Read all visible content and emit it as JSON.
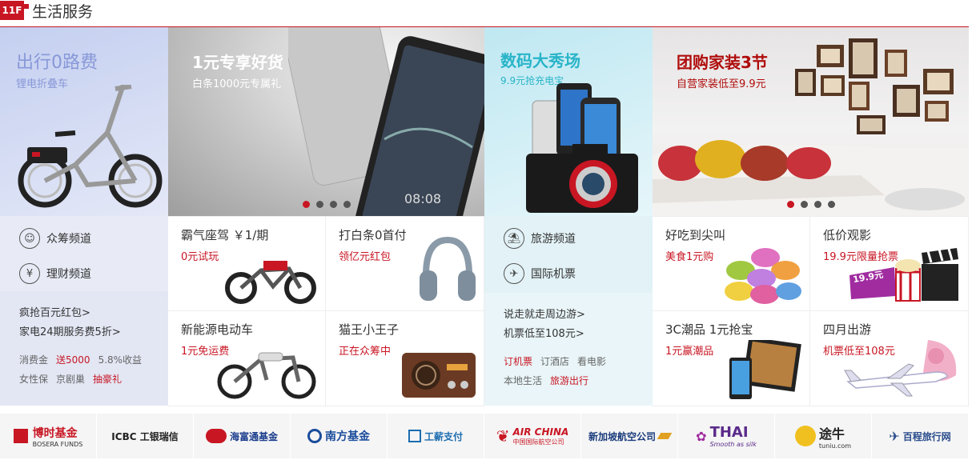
{
  "floor": {
    "number": "11F",
    "title": "生活服务"
  },
  "col1": {
    "title": "出行0路费",
    "subtitle": "锂电折叠车",
    "menu": [
      {
        "label": "众筹频道",
        "icon": "crowdfunding-icon"
      },
      {
        "label": "理财频道",
        "icon": "yen-icon"
      }
    ],
    "links": [
      "疯抢百元红包>",
      "家电24期服务费5折>"
    ],
    "tags": [
      {
        "text": "消费金",
        "hot": false
      },
      {
        "text": "送5000",
        "hot": true
      },
      {
        "text": "5.8%收益",
        "hot": false
      },
      {
        "text": "女性保",
        "hot": false
      },
      {
        "text": "京剧巢",
        "hot": false
      },
      {
        "text": "抽豪礼",
        "hot": true
      }
    ]
  },
  "col2": {
    "banner": {
      "title": "1元专享好货",
      "subtitle": "白条1000元专属礼",
      "slides": 4,
      "active": 0
    },
    "cells": [
      {
        "title": "霸气座驾 ￥1/期",
        "sub": "0元试玩",
        "art": "motorcycle"
      },
      {
        "title": "打白条0首付",
        "sub": "领亿元红包",
        "art": "headphones"
      },
      {
        "title": "新能源电动车",
        "sub": "1元免运费",
        "art": "ebike"
      },
      {
        "title": "猫王小王子",
        "sub": "正在众筹中",
        "art": "radio"
      }
    ]
  },
  "col3": {
    "title": "数码大秀场",
    "subtitle": "9.9元抢充电宝",
    "menu": [
      {
        "label": "旅游频道",
        "icon": "beach-icon"
      },
      {
        "label": "国际机票",
        "icon": "plane-icon"
      }
    ],
    "links": [
      "说走就走周边游>",
      "机票低至108元>"
    ],
    "tags": [
      {
        "text": "订机票",
        "hot": true
      },
      {
        "text": "订酒店",
        "hot": false
      },
      {
        "text": "看电影",
        "hot": false
      },
      {
        "text": "本地生活",
        "hot": false
      },
      {
        "text": "旅游出行",
        "hot": true
      }
    ]
  },
  "col4": {
    "banner": {
      "title": "团购家装3节",
      "subtitle": "自营家装低至9.9元",
      "slides": 4,
      "active": 0
    },
    "cells": [
      {
        "title": "好吃到尖叫",
        "sub": "美食1元购",
        "art": "macarons"
      },
      {
        "title": "低价观影",
        "sub": "19.9元限量抢票",
        "art": "movie",
        "badge": "19.9元"
      },
      {
        "title": "3C潮品 1元抢宝",
        "sub": "1元赢潮品",
        "art": "tablets"
      },
      {
        "title": "四月出游",
        "sub": "机票低至108元",
        "art": "airplane"
      }
    ]
  },
  "logos": [
    {
      "name": "博时基金",
      "en": "BOSERA FUNDS",
      "color": "#c81623"
    },
    {
      "name": "ICBC 工银瑞信",
      "en": "",
      "color": "#222222"
    },
    {
      "name": "海富通基金",
      "en": "",
      "color": "#1a3c8c"
    },
    {
      "name": "南方基金",
      "en": "",
      "color": "#1a4c9c"
    },
    {
      "name": "工薪支付",
      "en": "",
      "color": "#1a6cb0"
    },
    {
      "name": "AIR CHINA",
      "en": "中国国际航空公司",
      "color": "#c81623"
    },
    {
      "name": "新加坡航空公司",
      "en": "",
      "color": "#1a3c7c"
    },
    {
      "name": "THAI",
      "en": "Smooth as silk",
      "color": "#5a2a8a"
    },
    {
      "name": "途牛",
      "en": "tuniu.com",
      "color": "#222222"
    },
    {
      "name": "百程旅行网",
      "en": "",
      "color": "#2a4c8c"
    }
  ]
}
